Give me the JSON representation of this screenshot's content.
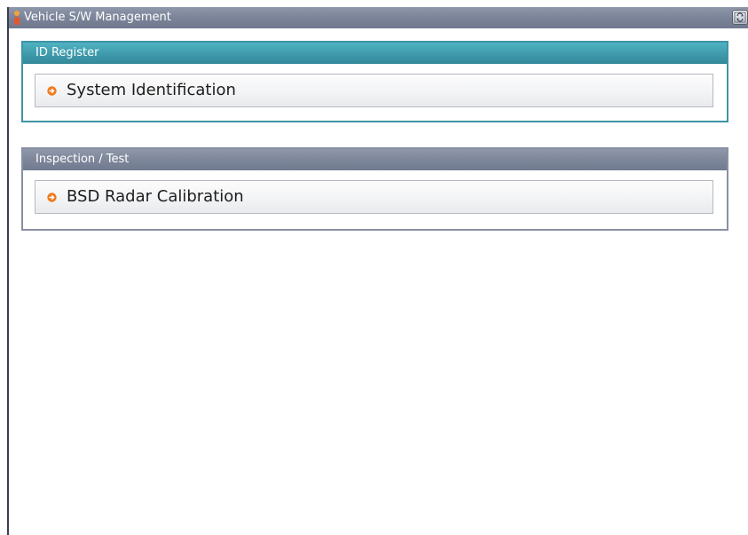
{
  "window": {
    "title": "Vehicle S/W Management"
  },
  "sections": [
    {
      "title": "ID Register",
      "items": [
        {
          "label": "System Identification",
          "icon": "orange-arrow-bullet-icon"
        }
      ]
    },
    {
      "title": "Inspection / Test",
      "items": [
        {
          "label": "BSD Radar Calibration",
          "icon": "orange-arrow-bullet-icon"
        }
      ]
    }
  ],
  "colors": {
    "titlebar": "#7b8499",
    "id_register_accent": "#3f94a4",
    "inspection_accent": "#8890a4",
    "bullet": "#f07a1e"
  }
}
